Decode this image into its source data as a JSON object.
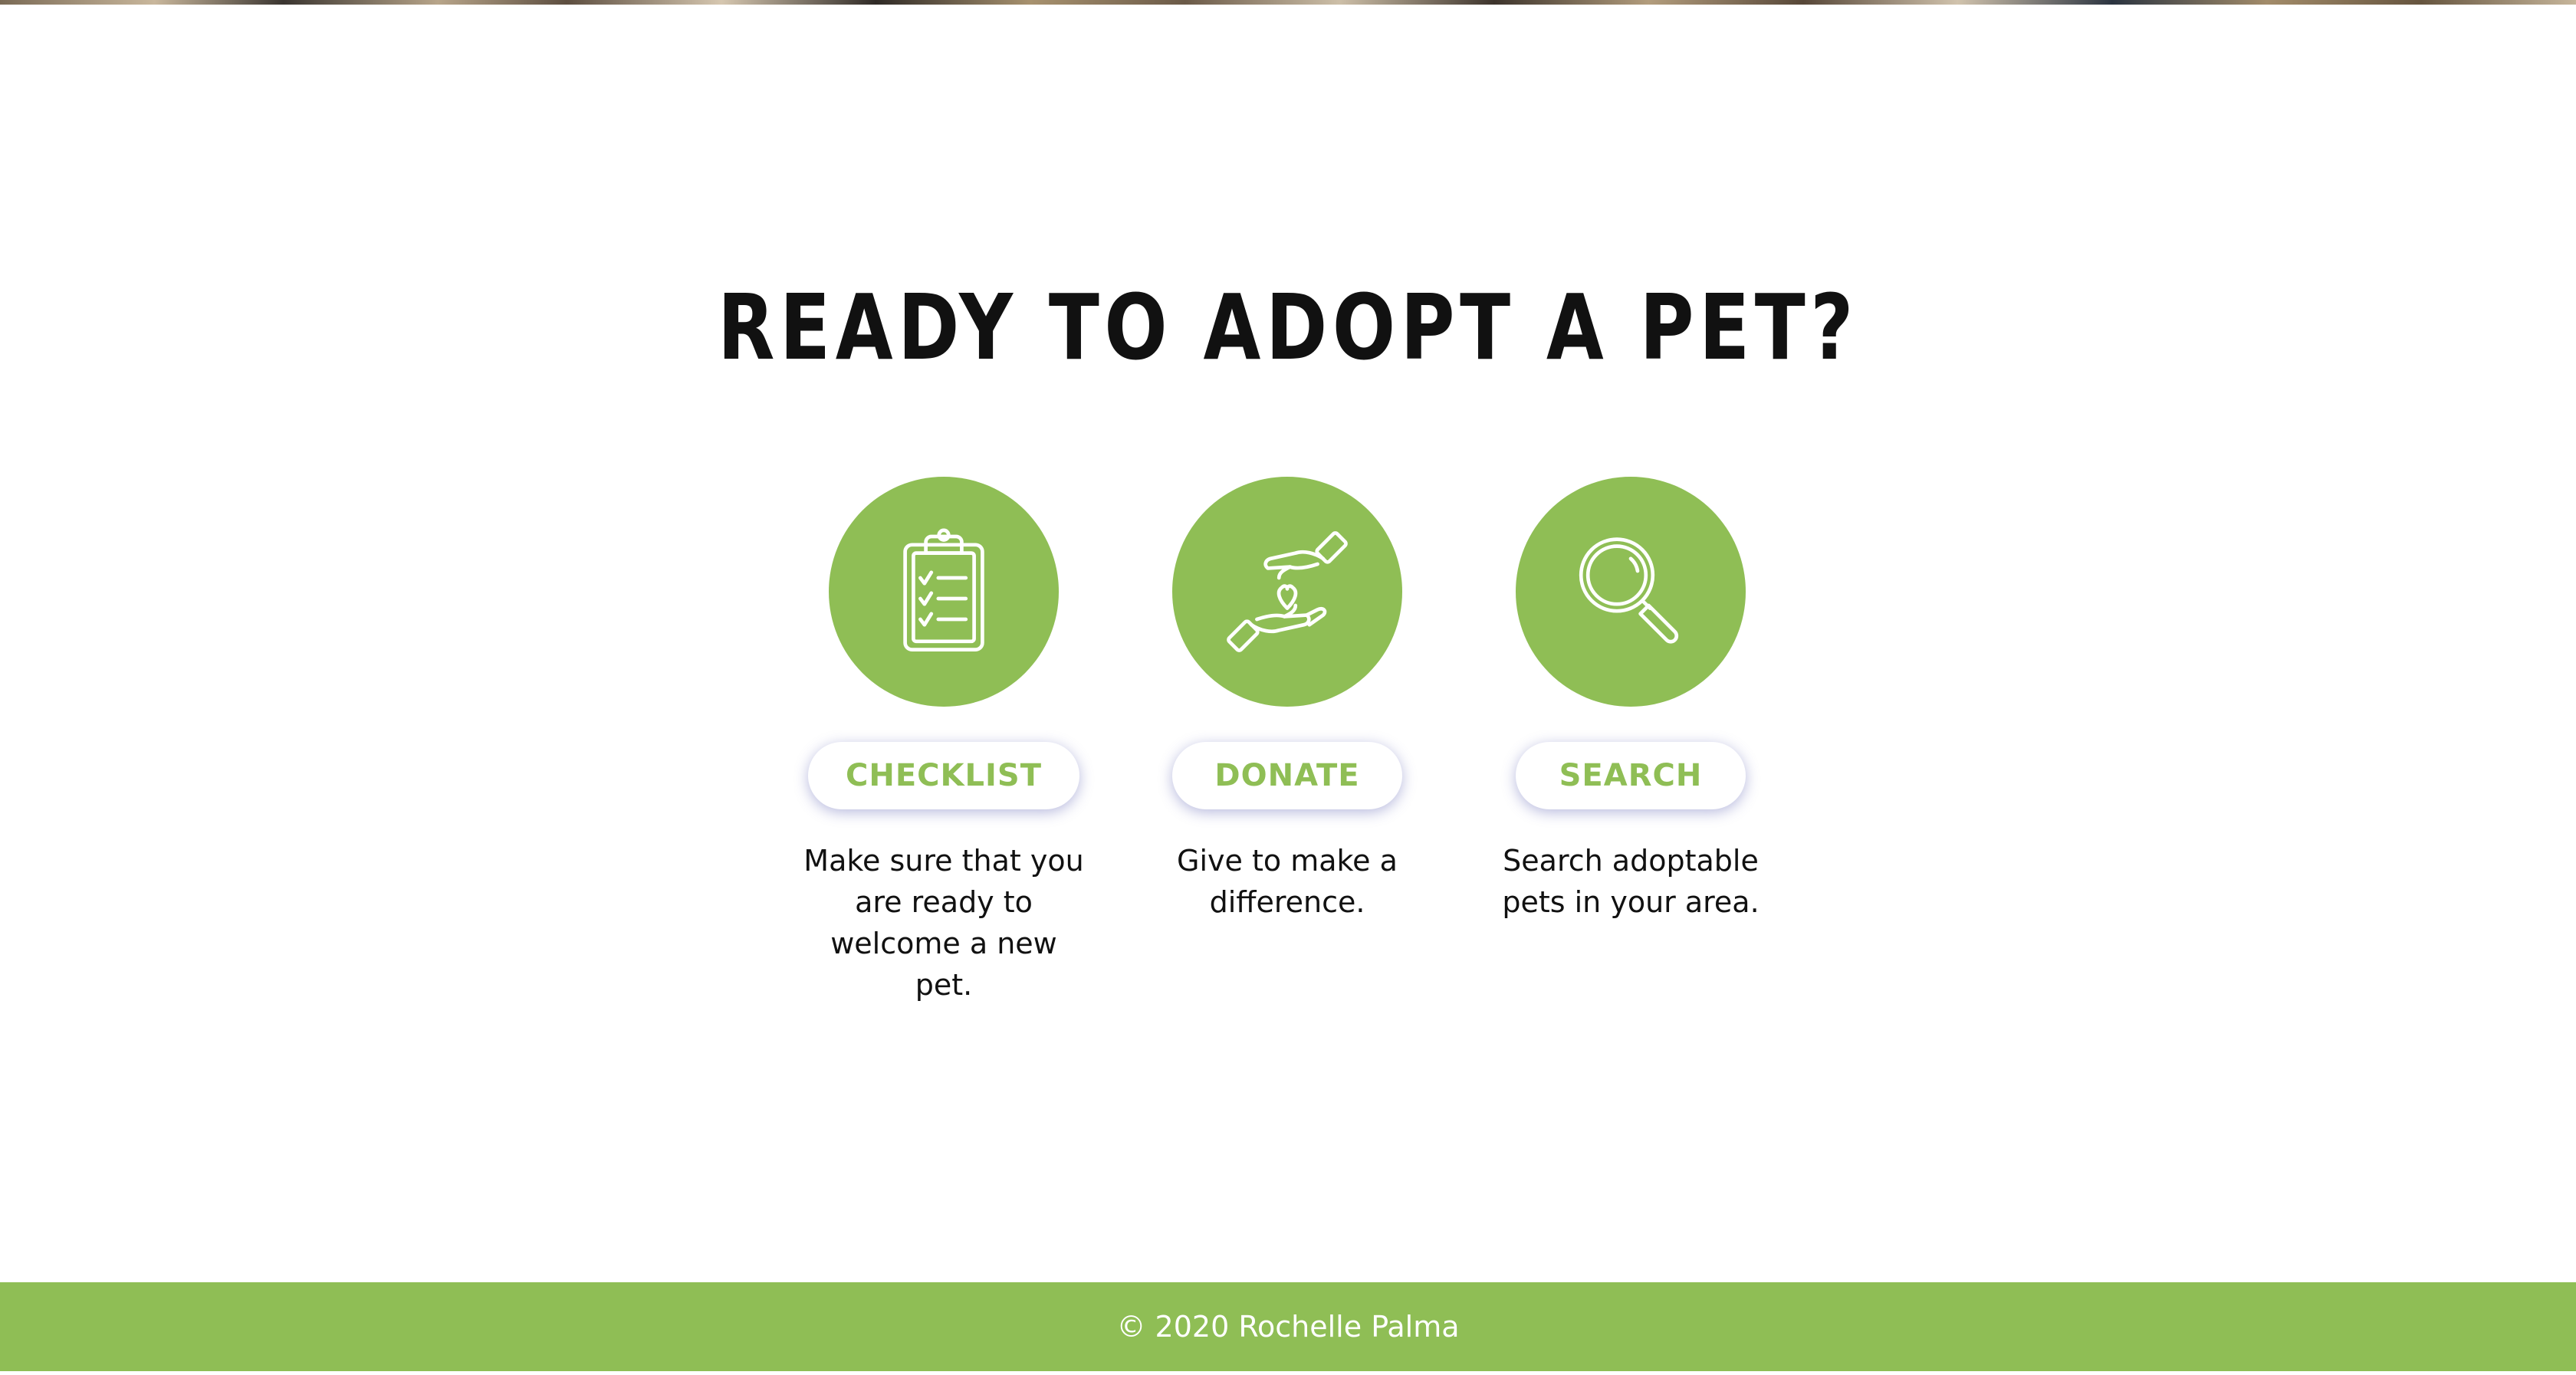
{
  "colors": {
    "accent_green": "#8fbe55",
    "text_dark": "#111111",
    "background": "#ffffff",
    "footer_text": "#ffffff"
  },
  "section": {
    "title": "READY TO ADOPT A PET?"
  },
  "cards": [
    {
      "icon": "clipboard-checklist-icon",
      "button_label": "CHECKLIST",
      "description": "Make sure that you are ready to welcome a new pet."
    },
    {
      "icon": "hands-heart-icon",
      "button_label": "DONATE",
      "description": "Give to make a difference."
    },
    {
      "icon": "magnifying-glass-icon",
      "button_label": "SEARCH",
      "description": "Search adoptable pets in your area."
    }
  ],
  "footer": {
    "copyright": "© 2020 Rochelle Palma"
  }
}
